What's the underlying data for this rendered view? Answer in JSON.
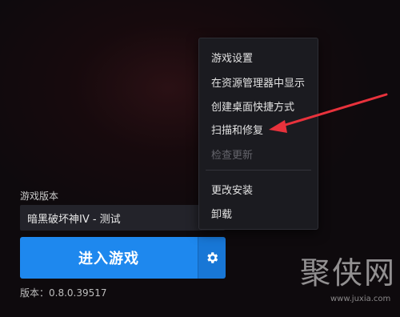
{
  "game_panel": {
    "version_label": "游戏版本",
    "selected_version": "暗黑破坏神IV - 测试",
    "play_label": "进入游戏",
    "version_info": "版本：0.8.0.39517"
  },
  "context_menu": {
    "items": [
      {
        "label": "游戏设置",
        "enabled": true
      },
      {
        "label": "在资源管理器中显示",
        "enabled": true
      },
      {
        "label": "创建桌面快捷方式",
        "enabled": true
      },
      {
        "label": "扫描和修复",
        "enabled": true
      },
      {
        "label": "检查更新",
        "enabled": false
      },
      {
        "label": "更改安装",
        "enabled": true
      },
      {
        "label": "卸载",
        "enabled": true
      }
    ]
  },
  "annotation": {
    "color": "#e8323c",
    "icon": "red-arrow-icon"
  },
  "watermark": {
    "text": "聚侠网",
    "url": "www.juxia.com"
  },
  "colors": {
    "accent": "#1e88ee",
    "menu_bg": "#1b1b20"
  }
}
